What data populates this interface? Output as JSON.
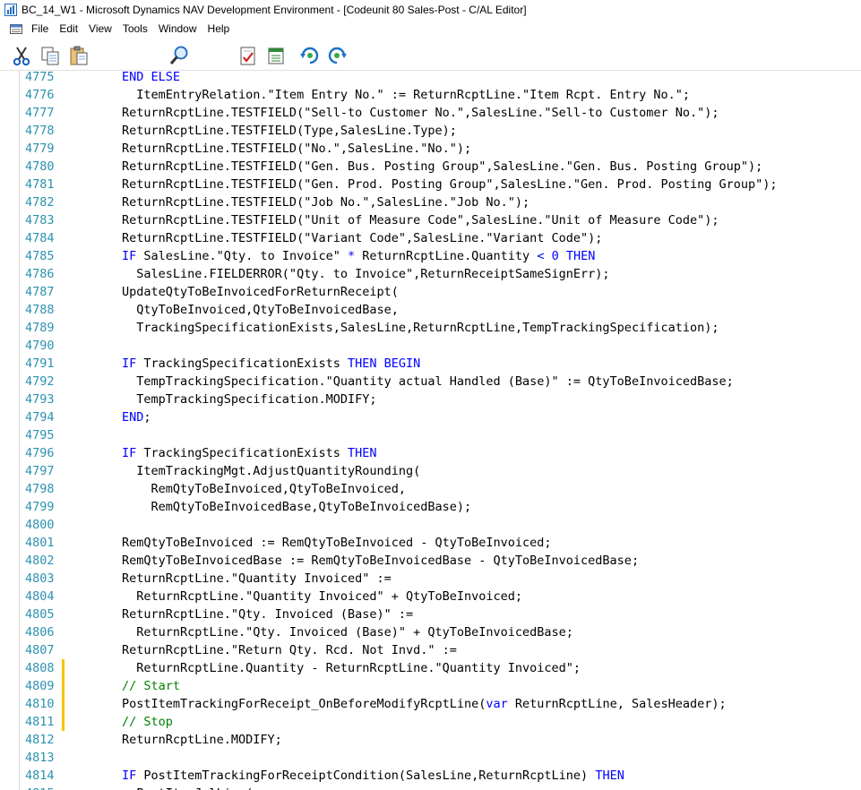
{
  "window": {
    "title": "BC_14_W1 - Microsoft Dynamics NAV Development Environment - [Codeunit 80 Sales-Post - C/AL Editor]"
  },
  "menu": {
    "items": [
      "File",
      "Edit",
      "View",
      "Tools",
      "Window",
      "Help"
    ]
  },
  "toolbar": {
    "icons": [
      "cut-icon",
      "copy-icon",
      "paste-icon",
      "find-icon",
      "compile-icon",
      "design-icon",
      "back-icon",
      "forward-icon"
    ]
  },
  "editor": {
    "lines": [
      {
        "n": "4775",
        "segs": [
          {
            "t": "END ELSE",
            "c": "kw"
          }
        ]
      },
      {
        "n": "4776",
        "segs": [
          {
            "t": "  ItemEntryRelation.\"Item Entry No.\" := ReturnRcptLine.\"Item Rcpt. Entry No.\";",
            "c": ""
          }
        ]
      },
      {
        "n": "4777",
        "segs": [
          {
            "t": "ReturnRcptLine.TESTFIELD(\"Sell-to Customer No.\",SalesLine.\"Sell-to Customer No.\");",
            "c": ""
          }
        ]
      },
      {
        "n": "4778",
        "segs": [
          {
            "t": "ReturnRcptLine.TESTFIELD(Type,SalesLine.Type);",
            "c": ""
          }
        ]
      },
      {
        "n": "4779",
        "segs": [
          {
            "t": "ReturnRcptLine.TESTFIELD(\"No.\",SalesLine.\"No.\");",
            "c": ""
          }
        ]
      },
      {
        "n": "4780",
        "segs": [
          {
            "t": "ReturnRcptLine.TESTFIELD(\"Gen. Bus. Posting Group\",SalesLine.\"Gen. Bus. Posting Group\");",
            "c": ""
          }
        ]
      },
      {
        "n": "4781",
        "segs": [
          {
            "t": "ReturnRcptLine.TESTFIELD(\"Gen. Prod. Posting Group\",SalesLine.\"Gen. Prod. Posting Group\");",
            "c": ""
          }
        ]
      },
      {
        "n": "4782",
        "segs": [
          {
            "t": "ReturnRcptLine.TESTFIELD(\"Job No.\",SalesLine.\"Job No.\");",
            "c": ""
          }
        ]
      },
      {
        "n": "4783",
        "segs": [
          {
            "t": "ReturnRcptLine.TESTFIELD(\"Unit of Measure Code\",SalesLine.\"Unit of Measure Code\");",
            "c": ""
          }
        ]
      },
      {
        "n": "4784",
        "segs": [
          {
            "t": "ReturnRcptLine.TESTFIELD(\"Variant Code\",SalesLine.\"Variant Code\");",
            "c": ""
          }
        ]
      },
      {
        "n": "4785",
        "segs": [
          {
            "t": "IF",
            "c": "kw"
          },
          {
            "t": " SalesLine.\"Qty. to Invoice\" ",
            "c": ""
          },
          {
            "t": "*",
            "c": "kw"
          },
          {
            "t": " ReturnRcptLine.Quantity ",
            "c": ""
          },
          {
            "t": "<",
            "c": "kw"
          },
          {
            "t": " ",
            "c": ""
          },
          {
            "t": "0",
            "c": "kw"
          },
          {
            "t": " ",
            "c": ""
          },
          {
            "t": "THEN",
            "c": "kw"
          }
        ]
      },
      {
        "n": "4786",
        "segs": [
          {
            "t": "  SalesLine.FIELDERROR(\"Qty. to Invoice\",ReturnReceiptSameSignErr);",
            "c": ""
          }
        ]
      },
      {
        "n": "4787",
        "segs": [
          {
            "t": "UpdateQtyToBeInvoicedForReturnReceipt(",
            "c": ""
          }
        ]
      },
      {
        "n": "4788",
        "segs": [
          {
            "t": "  QtyToBeInvoiced,QtyToBeInvoicedBase,",
            "c": ""
          }
        ]
      },
      {
        "n": "4789",
        "segs": [
          {
            "t": "  TrackingSpecificationExists,SalesLine,ReturnRcptLine,TempTrackingSpecification);",
            "c": ""
          }
        ]
      },
      {
        "n": "4790",
        "segs": []
      },
      {
        "n": "4791",
        "segs": [
          {
            "t": "IF",
            "c": "kw"
          },
          {
            "t": " TrackingSpecificationExists ",
            "c": ""
          },
          {
            "t": "THEN BEGIN",
            "c": "kw"
          }
        ]
      },
      {
        "n": "4792",
        "segs": [
          {
            "t": "  TempTrackingSpecification.\"Quantity actual Handled (Base)\" := QtyToBeInvoicedBase;",
            "c": ""
          }
        ]
      },
      {
        "n": "4793",
        "segs": [
          {
            "t": "  TempTrackingSpecification.MODIFY;",
            "c": ""
          }
        ]
      },
      {
        "n": "4794",
        "segs": [
          {
            "t": "END",
            "c": "kw"
          },
          {
            "t": ";",
            "c": ""
          }
        ]
      },
      {
        "n": "4795",
        "segs": []
      },
      {
        "n": "4796",
        "segs": [
          {
            "t": "IF",
            "c": "kw"
          },
          {
            "t": " TrackingSpecificationExists ",
            "c": ""
          },
          {
            "t": "THEN",
            "c": "kw"
          }
        ]
      },
      {
        "n": "4797",
        "segs": [
          {
            "t": "  ItemTrackingMgt.AdjustQuantityRounding(",
            "c": ""
          }
        ]
      },
      {
        "n": "4798",
        "segs": [
          {
            "t": "    RemQtyToBeInvoiced,QtyToBeInvoiced,",
            "c": ""
          }
        ]
      },
      {
        "n": "4799",
        "segs": [
          {
            "t": "    RemQtyToBeInvoicedBase,QtyToBeInvoicedBase);",
            "c": ""
          }
        ]
      },
      {
        "n": "4800",
        "segs": []
      },
      {
        "n": "4801",
        "segs": [
          {
            "t": "RemQtyToBeInvoiced := RemQtyToBeInvoiced - QtyToBeInvoiced;",
            "c": ""
          }
        ]
      },
      {
        "n": "4802",
        "segs": [
          {
            "t": "RemQtyToBeInvoicedBase := RemQtyToBeInvoicedBase - QtyToBeInvoicedBase;",
            "c": ""
          }
        ]
      },
      {
        "n": "4803",
        "segs": [
          {
            "t": "ReturnRcptLine.\"Quantity Invoiced\" :=",
            "c": ""
          }
        ]
      },
      {
        "n": "4804",
        "segs": [
          {
            "t": "  ReturnRcptLine.\"Quantity Invoiced\" + QtyToBeInvoiced;",
            "c": ""
          }
        ]
      },
      {
        "n": "4805",
        "segs": [
          {
            "t": "ReturnRcptLine.\"Qty. Invoiced (Base)\" :=",
            "c": ""
          }
        ]
      },
      {
        "n": "4806",
        "segs": [
          {
            "t": "  ReturnRcptLine.\"Qty. Invoiced (Base)\" + QtyToBeInvoicedBase;",
            "c": ""
          }
        ]
      },
      {
        "n": "4807",
        "segs": [
          {
            "t": "ReturnRcptLine.\"Return Qty. Rcd. Not Invd.\" :=",
            "c": ""
          }
        ]
      },
      {
        "n": "4808",
        "segs": [
          {
            "t": "  ReturnRcptLine.Quantity - ReturnRcptLine.\"Quantity Invoiced\";",
            "c": ""
          }
        ],
        "changed": true
      },
      {
        "n": "4809",
        "segs": [
          {
            "t": "// Start",
            "c": "cm"
          }
        ],
        "changed": true
      },
      {
        "n": "4810",
        "segs": [
          {
            "t": "PostItemTrackingForReceipt_OnBeforeModifyRcptLine(",
            "c": ""
          },
          {
            "t": "var",
            "c": "kw"
          },
          {
            "t": " ReturnRcptLine, SalesHeader);",
            "c": ""
          }
        ],
        "changed": true
      },
      {
        "n": "4811",
        "segs": [
          {
            "t": "// Stop",
            "c": "cm"
          }
        ],
        "changed": true
      },
      {
        "n": "4812",
        "segs": [
          {
            "t": "ReturnRcptLine.MODIFY;",
            "c": ""
          }
        ]
      },
      {
        "n": "4813",
        "segs": []
      },
      {
        "n": "4814",
        "segs": [
          {
            "t": "IF",
            "c": "kw"
          },
          {
            "t": " PostItemTrackingForReceiptCondition(SalesLine,ReturnRcptLine) ",
            "c": ""
          },
          {
            "t": "THEN",
            "c": "kw"
          }
        ]
      },
      {
        "n": "4815",
        "segs": [
          {
            "t": "  PostItemJnlLine(",
            "c": ""
          }
        ]
      }
    ]
  }
}
